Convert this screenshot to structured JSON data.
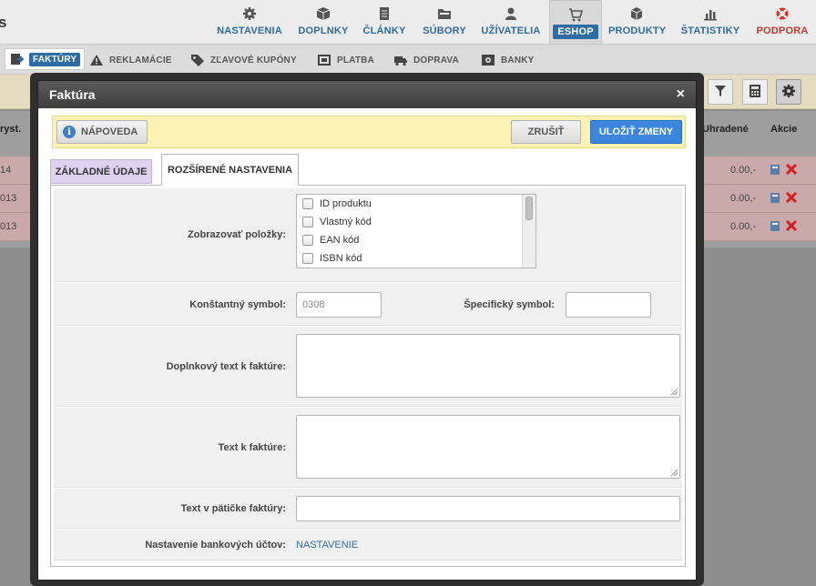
{
  "logo_fragment": "s",
  "topnav": {
    "items": [
      {
        "label": "NASTAVENIA",
        "icon": "gear-icon"
      },
      {
        "label": "DOPLNKY",
        "icon": "box-icon"
      },
      {
        "label": "ČLÁNKY",
        "icon": "document-icon"
      },
      {
        "label": "SÚBORY",
        "icon": "folder-icon"
      },
      {
        "label": "UŽÍVATELIA",
        "icon": "user-icon"
      },
      {
        "label": "ESHOP",
        "icon": "cart-icon"
      },
      {
        "label": "PRODUKTY",
        "icon": "cube-icon"
      },
      {
        "label": "ŠTATISTIKY",
        "icon": "bar-chart-icon"
      },
      {
        "label": "PODPORA",
        "icon": "lifebuoy-icon"
      }
    ]
  },
  "subnav": {
    "items": [
      {
        "label": "FAKTÚRY",
        "icon": "invoice-icon"
      },
      {
        "label": "REKLAMÁCIE",
        "icon": "warning-icon"
      },
      {
        "label": "ZĽAVOVÉ KUPÓNY",
        "icon": "tag-icon"
      },
      {
        "label": "PLATBA",
        "icon": "payment-icon"
      },
      {
        "label": "DOPRAVA",
        "icon": "truck-icon"
      },
      {
        "label": "BANKY",
        "icon": "bank-icon"
      }
    ]
  },
  "background": {
    "headers": {
      "issued": "ryst.",
      "paid": "Uhradené",
      "actions": "Akcie"
    },
    "rows": [
      {
        "year": "14",
        "amount": "0.00,-"
      },
      {
        "year": "013",
        "amount": "0.00,-"
      },
      {
        "year": "013",
        "amount": "0.00,-"
      }
    ]
  },
  "modal": {
    "title": "Faktúra",
    "close": "×",
    "help_label": "NÁPOVEDA",
    "cancel_label": "ZRUŠIŤ",
    "save_label": "ULOŽIŤ ZMENY",
    "tabs": {
      "basic": "ZÁKLADNÉ ÚDAJE",
      "advanced": "ROZŠÍRENÉ NASTAVENIA"
    },
    "form": {
      "display_items_label": "Zobrazovať položky:",
      "display_items": [
        "ID produktu",
        "Vlastný kód",
        "EAN kód",
        "ISBN kód"
      ],
      "constant_symbol_label": "Konštantný symbol:",
      "constant_symbol_placeholder": "0308",
      "specific_symbol_label": "Špecifický symbol:",
      "additional_text_label": "Doplnkový text k faktúre:",
      "invoice_text_label": "Text k faktúre:",
      "footer_text_label": "Text v pätičke faktúry:",
      "bank_accounts_label": "Nastavenie bankových účtov:",
      "bank_accounts_link": "NASTAVENIE"
    }
  }
}
